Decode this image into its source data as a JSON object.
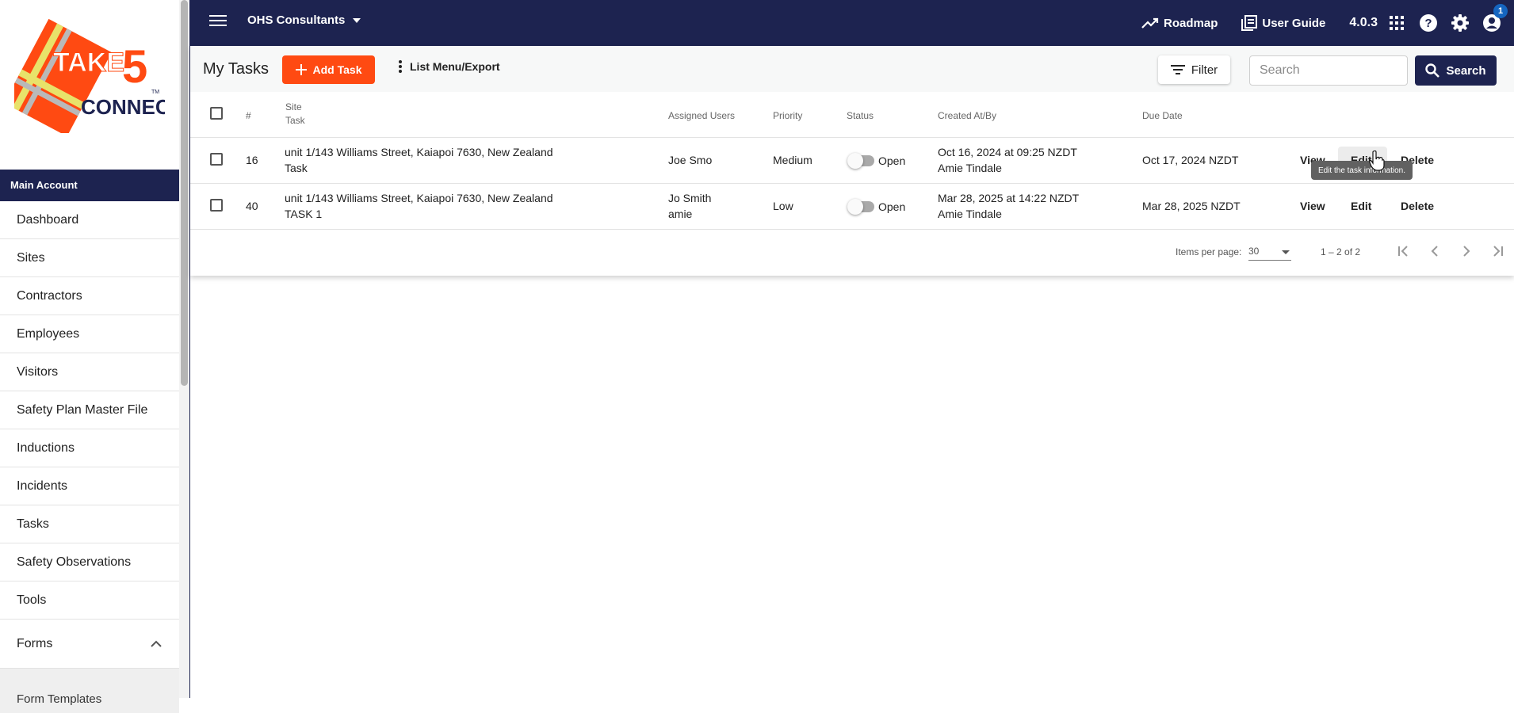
{
  "app": {
    "org_name": "OHS Consultants",
    "version": "4.0.3",
    "roadmap_label": "Roadmap",
    "user_guide_label": "User Guide",
    "notification_count": "1",
    "brand_color": "#1d2350",
    "accent_color": "#ff4a12"
  },
  "logo": {
    "line1": "TAKE",
    "line2": "5",
    "line3": "CONNECT",
    "tm": "TM"
  },
  "sidebar": {
    "account_label": "Main Account",
    "items": [
      {
        "label": "Dashboard"
      },
      {
        "label": "Sites"
      },
      {
        "label": "Contractors"
      },
      {
        "label": "Employees"
      },
      {
        "label": "Visitors"
      },
      {
        "label": "Safety Plan Master File"
      },
      {
        "label": "Inductions"
      },
      {
        "label": "Incidents"
      },
      {
        "label": "Tasks"
      },
      {
        "label": "Safety Observations"
      },
      {
        "label": "Tools"
      }
    ],
    "forms_label": "Forms",
    "forms_sub_label": "Form Templates"
  },
  "toolbar": {
    "title": "My Tasks",
    "add_label": "Add Task",
    "list_menu_label": "List Menu/Export",
    "filter_label": "Filter",
    "search_placeholder": "Search",
    "search_button_label": "Search"
  },
  "table": {
    "headers": {
      "number": "#",
      "site": "Site",
      "task": "Task",
      "assigned": "Assigned Users",
      "priority": "Priority",
      "status": "Status",
      "created": "Created At/By",
      "due": "Due Date"
    },
    "rows": [
      {
        "number": "16",
        "site": "unit 1/143 Williams Street, Kaiapoi 7630, New Zealand",
        "task": "Task",
        "assigned1": "Joe Smo",
        "assigned2": "",
        "priority": "Medium",
        "status": "Open",
        "created_at": "Oct 16, 2024 at 09:25 NZDT",
        "created_by": "Amie Tindale",
        "due": "Oct 17, 2024 NZDT",
        "view": "View",
        "edit": "Edit",
        "delete": "Delete"
      },
      {
        "number": "40",
        "site": "unit 1/143 Williams Street, Kaiapoi 7630, New Zealand",
        "task": "TASK 1",
        "assigned1": "Jo Smith",
        "assigned2": "amie",
        "priority": "Low",
        "status": "Open",
        "created_at": "Mar 28, 2025 at 14:22 NZDT",
        "created_by": "Amie Tindale",
        "due": "Mar 28, 2025 NZDT",
        "view": "View",
        "edit": "Edit",
        "delete": "Delete"
      }
    ],
    "tooltip": "Edit the task information."
  },
  "pager": {
    "items_label": "Items per page:",
    "per_page": "30",
    "range": "1 – 2 of 2"
  }
}
